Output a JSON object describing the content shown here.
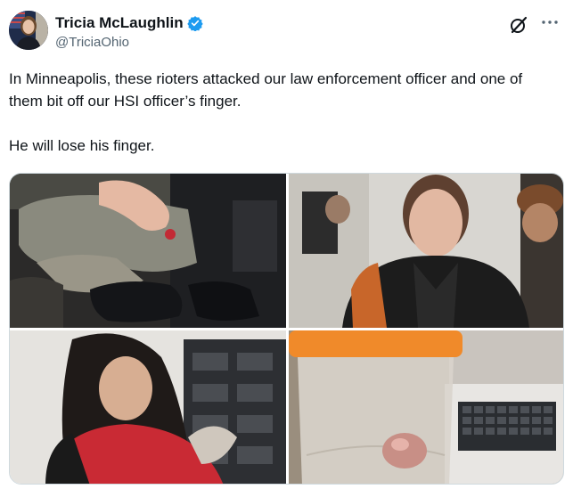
{
  "author": {
    "display_name": "Tricia McLaughlin",
    "handle": "@TriciaOhio",
    "verified": true,
    "verified_color": "#1d9bf0"
  },
  "icons": {
    "grok": "grok-slash-icon",
    "more": "more-horizontal-icon"
  },
  "tweet": {
    "line1": "In Minneapolis, these rioters attacked our law enforcement officer and one of them bit off our HSI officer’s finger.",
    "line2": "He will lose his finger."
  },
  "media": {
    "count": 4,
    "items": [
      "photo-hands-injury",
      "photo-man-in-jacket",
      "photo-person-red-coat",
      "photo-specimen-jar"
    ]
  }
}
